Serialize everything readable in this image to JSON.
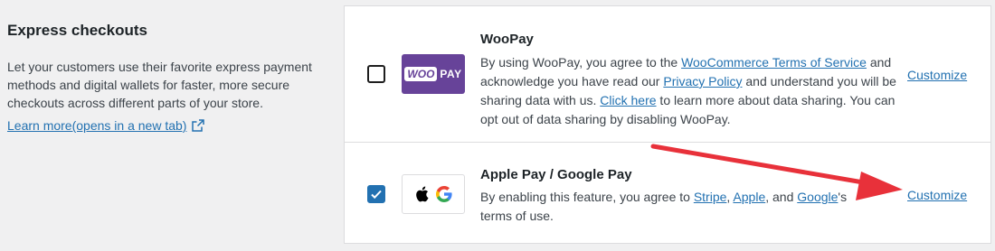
{
  "sidebar": {
    "title": "Express checkouts",
    "description": "Let your customers use their favorite express payment methods and digital wallets for faster, more secure checkouts across different parts of your store.",
    "learn_more": "Learn more(opens in a new tab)"
  },
  "methods": [
    {
      "name": "WooPay",
      "checked": false,
      "logo_box": "WOO",
      "logo_pay": "PAY",
      "desc_1": "By using WooPay, you agree to the ",
      "link_1": "WooCommerce Terms of Service",
      "desc_2": " and acknowledge you have read our ",
      "link_2": "Privacy Policy",
      "desc_3": " and understand you will be sharing data with us. ",
      "link_3": "Click here",
      "desc_4": " to learn more about data sharing. You can opt out of data sharing by disabling WooPay.",
      "customize": "Customize"
    },
    {
      "name": "Apple Pay / Google Pay",
      "checked": true,
      "logo_g": "G",
      "desc_1": "By enabling this feature, you agree to ",
      "link_1": "Stripe",
      "desc_2": ", ",
      "link_2": "Apple",
      "desc_3": ", and ",
      "link_3": "Google",
      "desc_4": "'s terms of use.",
      "customize": "Customize"
    }
  ],
  "colors": {
    "accent": "#2271b1",
    "woopay_purple": "#674399",
    "annotation_arrow": "#e8313a"
  }
}
